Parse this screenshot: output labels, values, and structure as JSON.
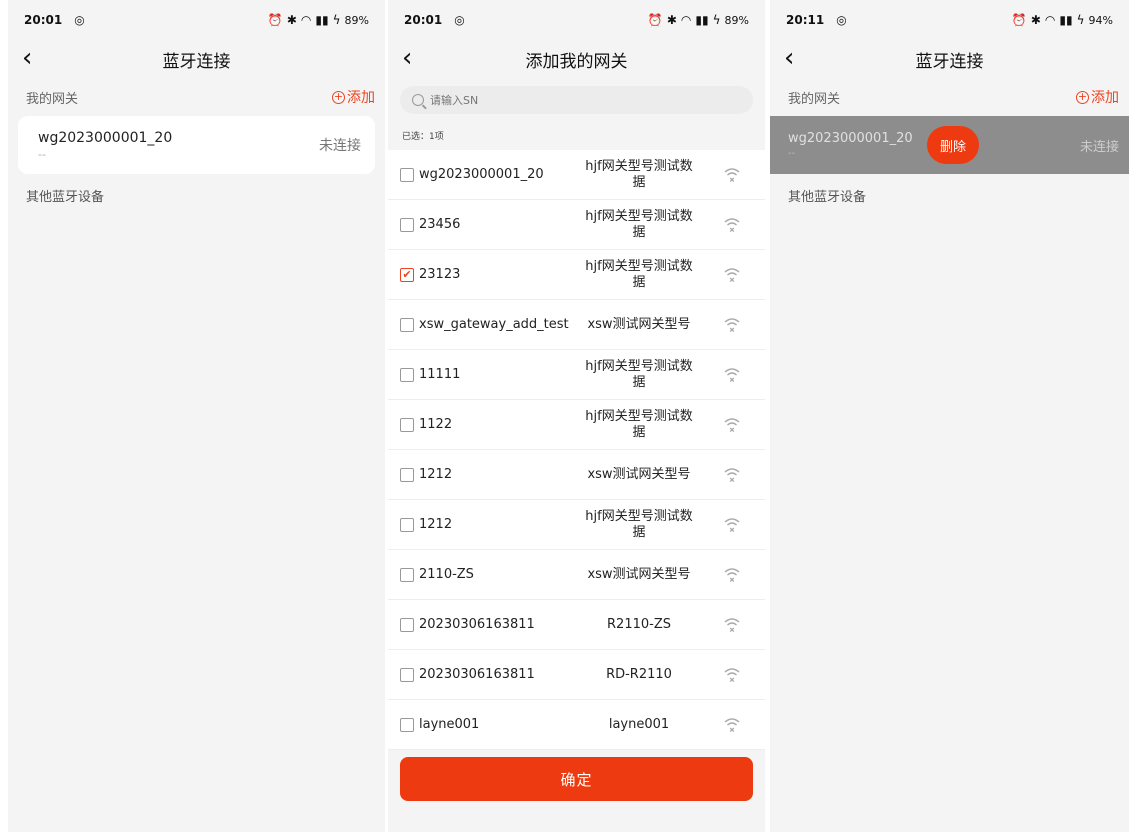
{
  "colors": {
    "accent": "#ee3a10",
    "link": "#ee4422",
    "background": "#f4f4f4"
  },
  "screen1": {
    "status": {
      "time": "20:01",
      "battery": "89%"
    },
    "title": "蓝牙连接",
    "my_gateways_label": "我的网关",
    "add_label": "添加",
    "gateway": {
      "name": "wg2023000001_20",
      "sub": "--",
      "status": "未连接"
    },
    "other_devices_label": "其他蓝牙设备"
  },
  "screen2": {
    "status": {
      "time": "20:01",
      "battery": "89%"
    },
    "title": "添加我的网关",
    "search_placeholder": "请输入SN",
    "selected_count": "已选：1项",
    "devices": [
      {
        "sn": "wg2023000001_20",
        "model": "hjf网关型号测试数据",
        "checked": false
      },
      {
        "sn": "23456",
        "model": "hjf网关型号测试数据",
        "checked": false
      },
      {
        "sn": "23123",
        "model": "hjf网关型号测试数据",
        "checked": true
      },
      {
        "sn": "xsw_gateway_add_test",
        "model": "xsw测试网关型号",
        "checked": false
      },
      {
        "sn": "11111",
        "model": "hjf网关型号测试数据",
        "checked": false
      },
      {
        "sn": "1122",
        "model": "hjf网关型号测试数据",
        "checked": false
      },
      {
        "sn": "1212",
        "model": "xsw测试网关型号",
        "checked": false
      },
      {
        "sn": "1212",
        "model": "hjf网关型号测试数据",
        "checked": false
      },
      {
        "sn": "2110-ZS",
        "model": "xsw测试网关型号",
        "checked": false
      },
      {
        "sn": "20230306163811",
        "model": "R2110-ZS",
        "checked": false
      },
      {
        "sn": "20230306163811",
        "model": "RD-R2110",
        "checked": false
      },
      {
        "sn": "layne001",
        "model": "layne001",
        "checked": false
      }
    ],
    "confirm_label": "确定"
  },
  "screen3": {
    "status": {
      "time": "20:11",
      "battery": "94%"
    },
    "title": "蓝牙连接",
    "my_gateways_label": "我的网关",
    "add_label": "添加",
    "gateway": {
      "name": "wg2023000001_20",
      "sub": "--",
      "status": "未连接"
    },
    "delete_label": "删除",
    "other_devices_label": "其他蓝牙设备"
  }
}
